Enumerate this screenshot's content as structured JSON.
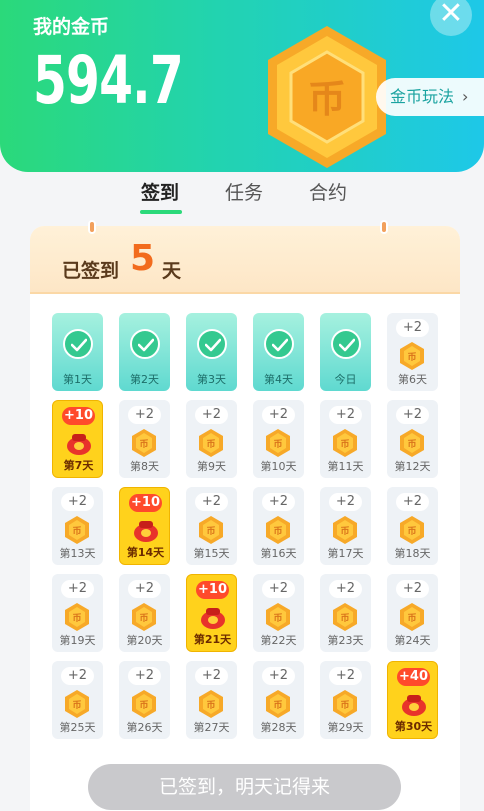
{
  "header": {
    "title": "我的金币",
    "balance": "594.7",
    "close": "✕",
    "rules_label": "金币玩法",
    "rules_chevron": "›",
    "coin_glyph": "币"
  },
  "tabs": [
    {
      "label": "签到",
      "active": true
    },
    {
      "label": "任务",
      "active": false
    },
    {
      "label": "合约",
      "active": false
    }
  ],
  "checkin": {
    "signed_prefix": "已签到",
    "signed_days": "5",
    "signed_suffix": "天",
    "days": [
      {
        "label": "第1天",
        "state": "done"
      },
      {
        "label": "第2天",
        "state": "done"
      },
      {
        "label": "第3天",
        "state": "done"
      },
      {
        "label": "第4天",
        "state": "done"
      },
      {
        "label": "今日",
        "state": "done"
      },
      {
        "label": "第6天",
        "state": "coin",
        "reward": "+2"
      },
      {
        "label": "第7天",
        "state": "special",
        "reward": "+10"
      },
      {
        "label": "第8天",
        "state": "coin",
        "reward": "+2"
      },
      {
        "label": "第9天",
        "state": "coin",
        "reward": "+2"
      },
      {
        "label": "第10天",
        "state": "coin",
        "reward": "+2"
      },
      {
        "label": "第11天",
        "state": "coin",
        "reward": "+2"
      },
      {
        "label": "第12天",
        "state": "coin",
        "reward": "+2"
      },
      {
        "label": "第13天",
        "state": "coin",
        "reward": "+2"
      },
      {
        "label": "第14天",
        "state": "special",
        "reward": "+10"
      },
      {
        "label": "第15天",
        "state": "coin",
        "reward": "+2"
      },
      {
        "label": "第16天",
        "state": "coin",
        "reward": "+2"
      },
      {
        "label": "第17天",
        "state": "coin",
        "reward": "+2"
      },
      {
        "label": "第18天",
        "state": "coin",
        "reward": "+2"
      },
      {
        "label": "第19天",
        "state": "coin",
        "reward": "+2"
      },
      {
        "label": "第20天",
        "state": "coin",
        "reward": "+2"
      },
      {
        "label": "第21天",
        "state": "special",
        "reward": "+10"
      },
      {
        "label": "第22天",
        "state": "coin",
        "reward": "+2"
      },
      {
        "label": "第23天",
        "state": "coin",
        "reward": "+2"
      },
      {
        "label": "第24天",
        "state": "coin",
        "reward": "+2"
      },
      {
        "label": "第25天",
        "state": "coin",
        "reward": "+2"
      },
      {
        "label": "第26天",
        "state": "coin",
        "reward": "+2"
      },
      {
        "label": "第27天",
        "state": "coin",
        "reward": "+2"
      },
      {
        "label": "第28天",
        "state": "coin",
        "reward": "+2"
      },
      {
        "label": "第29天",
        "state": "coin",
        "reward": "+2"
      },
      {
        "label": "第30天",
        "state": "special",
        "reward": "+40"
      }
    ],
    "button_label": "已签到，明天记得来"
  },
  "colors": {
    "header_green": "#2bd97a",
    "header_cyan": "#1ec8e8",
    "accent_orange": "#f26b1d",
    "special_yellow": "#ffd21c",
    "reward_red": "#ff4a2b"
  }
}
